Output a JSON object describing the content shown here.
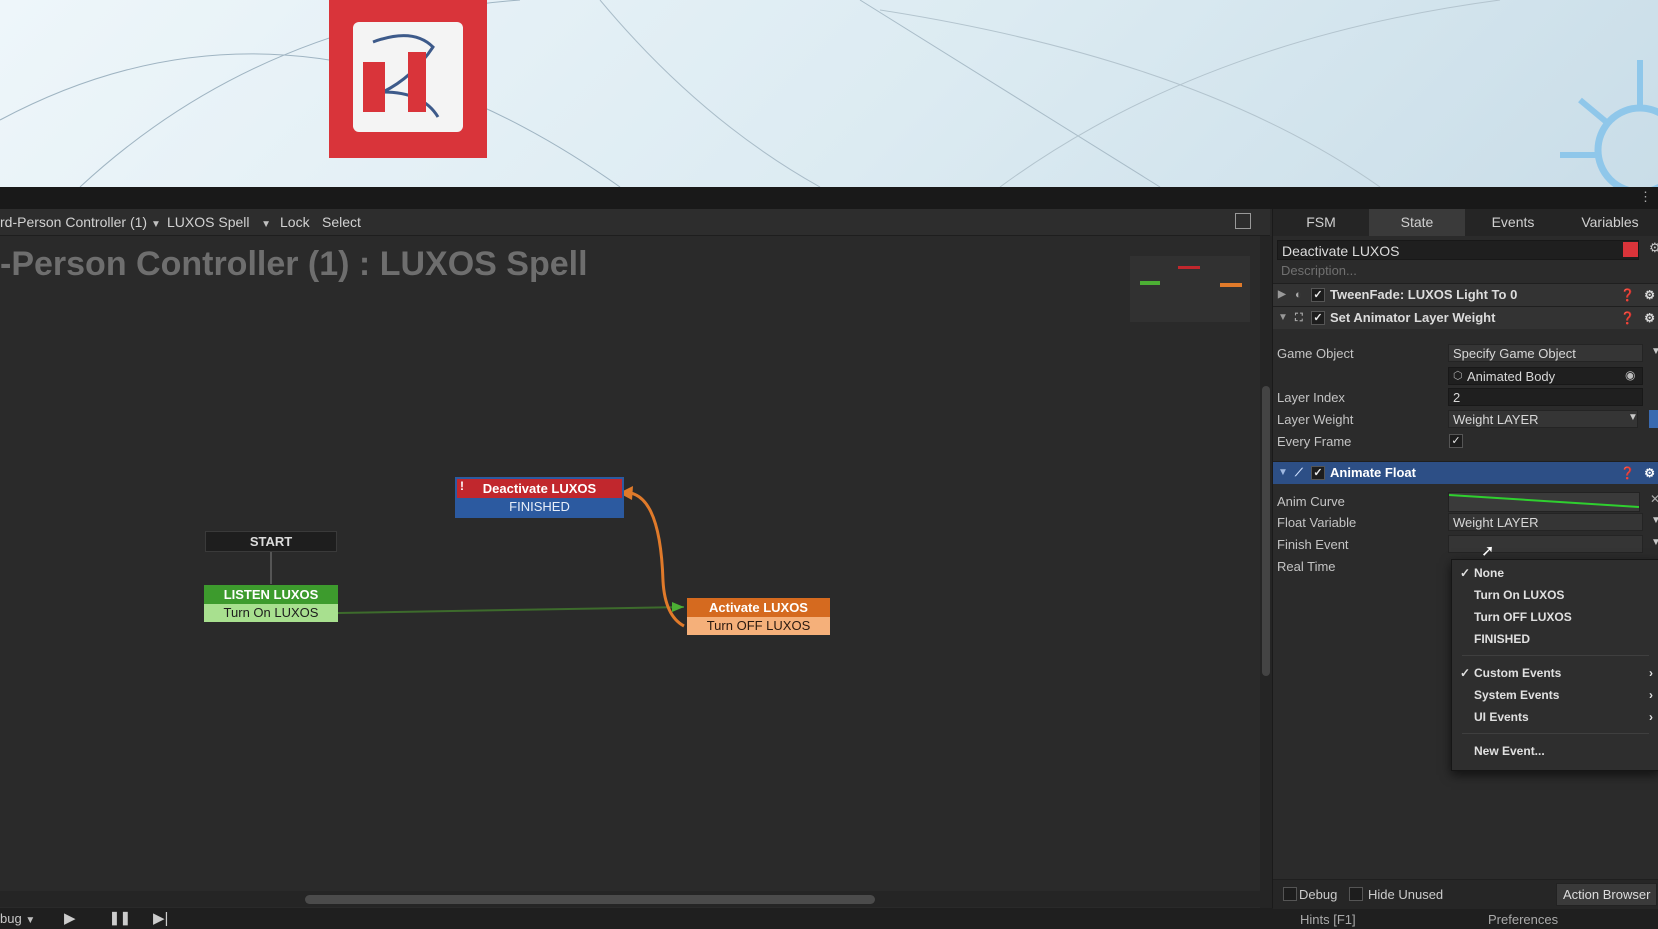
{
  "toolbar": {
    "fsm_owner": "rd-Person Controller (1)",
    "fsm_name": "LUXOS Spell",
    "lock_label": "Lock",
    "select_label": "Select"
  },
  "graph": {
    "title": "-Person Controller (1) : LUXOS Spell",
    "start_label": "START",
    "nodes": {
      "deactivate": {
        "name": "Deactivate LUXOS",
        "event": "FINISHED"
      },
      "listen": {
        "name": "LISTEN LUXOS",
        "event": "Turn On LUXOS"
      },
      "activate": {
        "name": "Activate LUXOS",
        "event": "Turn OFF LUXOS"
      }
    },
    "colors": {
      "red": "#c1272d",
      "blue": "#2c5aa0",
      "green": "#4caf34",
      "orange": "#e07a2a"
    }
  },
  "playback": {
    "debug_label": "bug"
  },
  "inspector": {
    "tabs": [
      "FSM",
      "State",
      "Events",
      "Variables"
    ],
    "state_name": "Deactivate LUXOS",
    "description_placeholder": "Description...",
    "actions": [
      {
        "title": "TweenFade: LUXOS Light  To 0"
      },
      {
        "title": "Set Animator Layer Weight"
      },
      {
        "title": "Animate Float"
      }
    ],
    "set_animator": {
      "game_object_label": "Game Object",
      "game_object_value": "Specify Game Object",
      "target_value": "Animated Body",
      "layer_index_label": "Layer Index",
      "layer_index_value": "2",
      "layer_weight_label": "Layer Weight",
      "layer_weight_value": "Weight LAYER",
      "every_frame_label": "Every Frame"
    },
    "animate_float": {
      "anim_curve_label": "Anim Curve",
      "float_variable_label": "Float Variable",
      "float_variable_value": "Weight LAYER",
      "finish_event_label": "Finish Event",
      "real_time_label": "Real Time"
    },
    "menu": {
      "items": [
        "None",
        "Turn On LUXOS",
        "Turn OFF LUXOS",
        "FINISHED"
      ],
      "submenus": [
        "Custom Events",
        "System Events",
        "UI Events"
      ],
      "new_event": "New Event..."
    },
    "footer": {
      "debug_label": "Debug",
      "hide_unused_label": "Hide Unused",
      "action_browser_label": "Action Browser",
      "hints_label": "Hints [F1]",
      "preferences_label": "Preferences"
    }
  }
}
